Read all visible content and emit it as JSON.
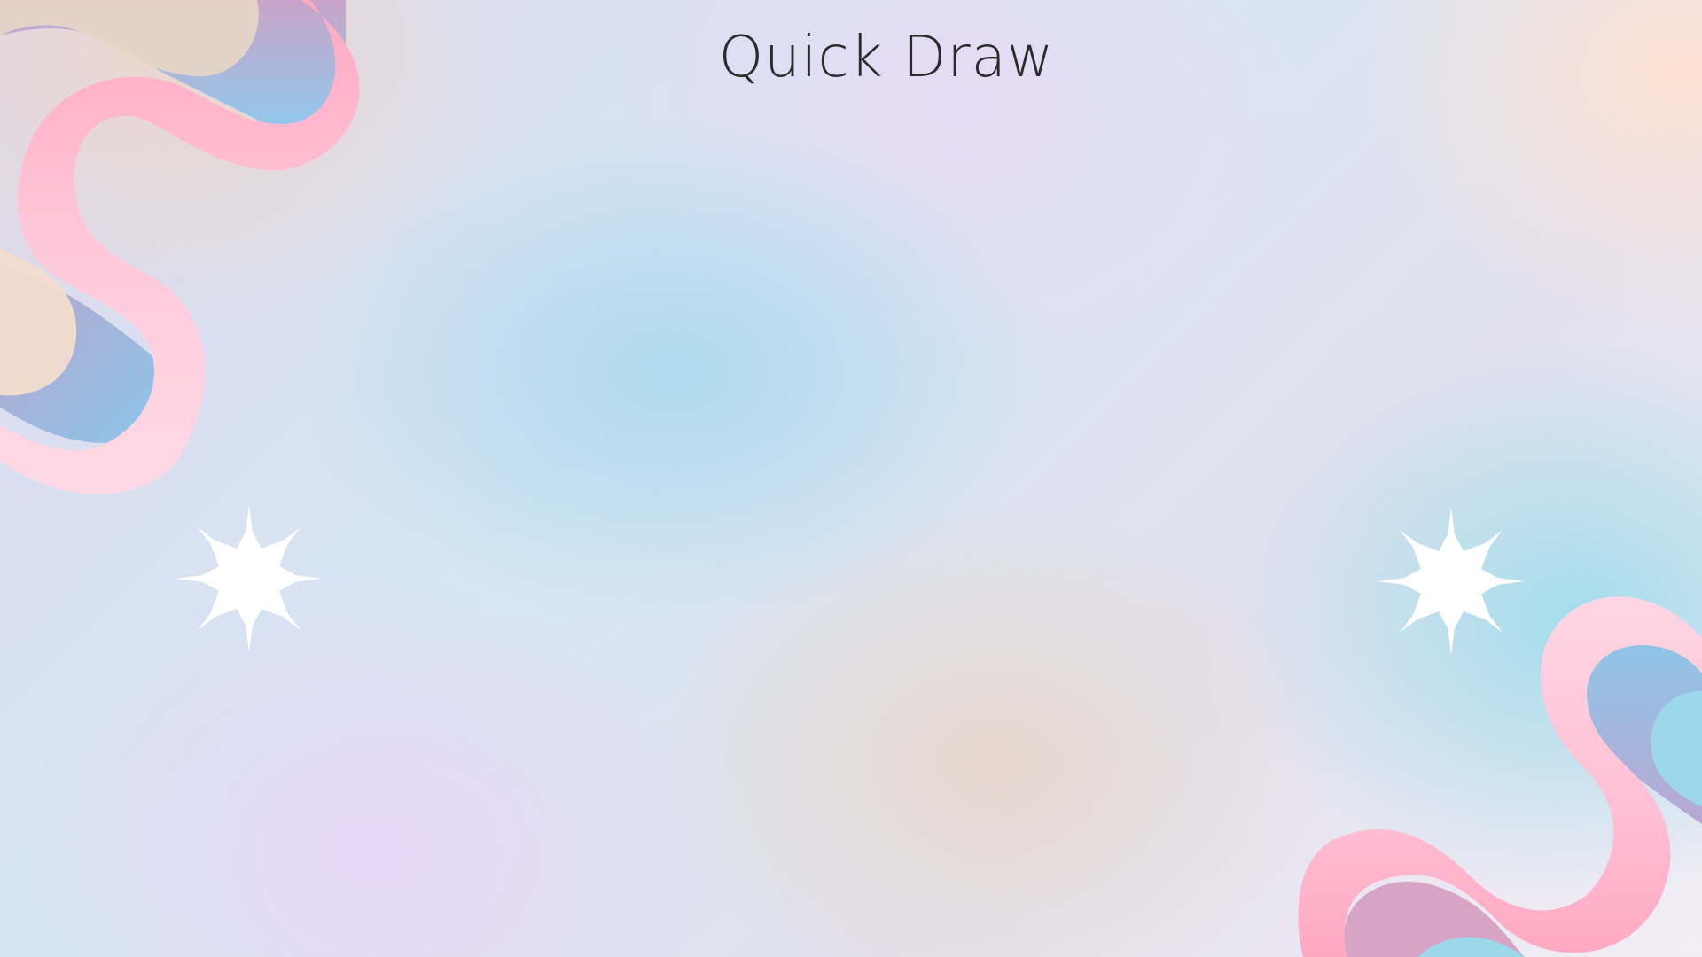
{
  "slide": {
    "title": "Quick Draw"
  },
  "decorations": {
    "top_left": "wavy-ribbon",
    "bottom_right": "wavy-ribbon",
    "left_star": "sparkle-star",
    "right_star": "sparkle-star"
  },
  "colors": {
    "ribbon_pink": "#ffc0d6",
    "ribbon_pink_light": "#ffdde8",
    "blob_blue": "#94c7e8",
    "blob_mauve": "#c9a8cc",
    "title_text": "#2b2b2b",
    "sparkle": "#ffffff"
  }
}
